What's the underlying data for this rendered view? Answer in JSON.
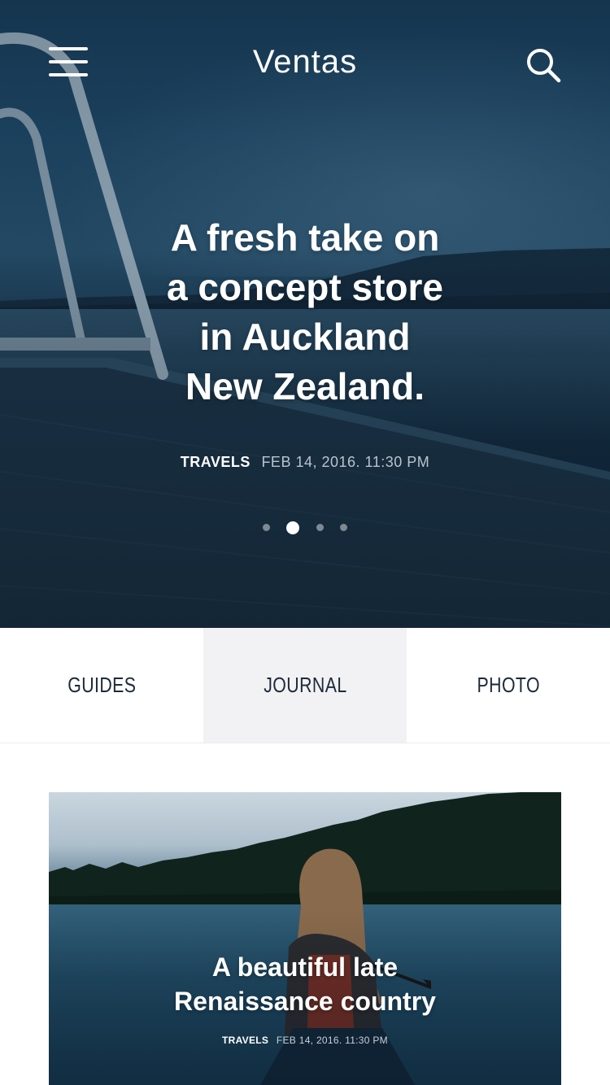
{
  "app": {
    "title": "Ventas"
  },
  "header": {
    "menu_icon": "hamburger-menu-icon",
    "search_icon": "search-icon"
  },
  "hero": {
    "title_lines": [
      "A fresh take on",
      "a concept store",
      "in Auckland",
      "New Zealand."
    ],
    "category": "TRAVELS",
    "date": "FEB 14, 2016. 11:30 PM",
    "slides_total": 4,
    "slide_active": 2
  },
  "tabs": [
    {
      "label": "GUIDES",
      "active": false
    },
    {
      "label": "JOURNAL",
      "active": true
    },
    {
      "label": "PHOTO",
      "active": false
    }
  ],
  "featured_card": {
    "title_lines": [
      "A beautiful late",
      "Renaissance country"
    ],
    "category": "TRAVELS",
    "date": "FEB 14, 2016. 11:30 PM"
  },
  "colors": {
    "tab_text": "#1d2a3a",
    "tab_active_bg": "#f2f2f4",
    "hero_date": "#b8c4cf"
  }
}
